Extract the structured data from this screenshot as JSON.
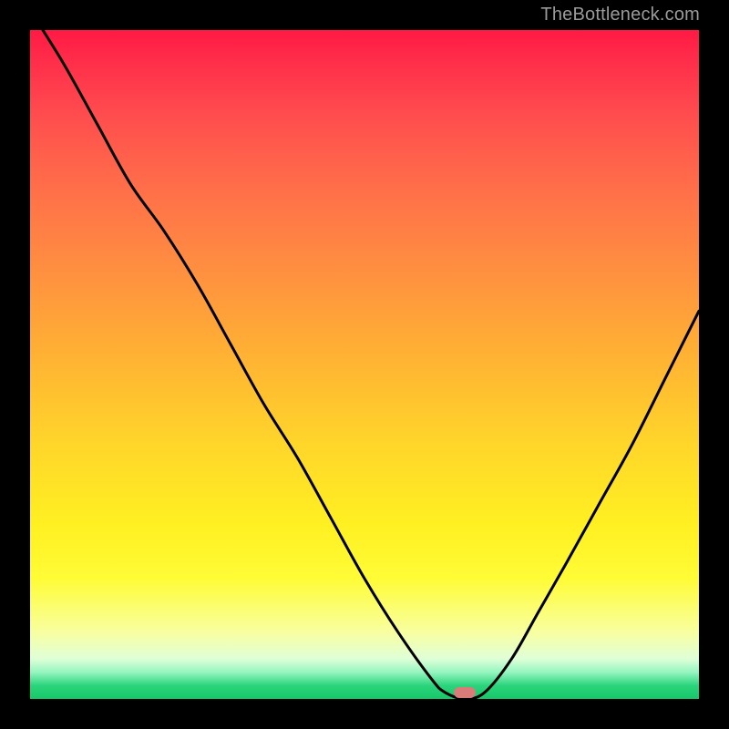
{
  "watermark": "TheBottleneck.com",
  "marker": {
    "x_pct": 65.0,
    "y_pct": 99.0
  },
  "colors": {
    "background": "#000000",
    "curve": "#000000",
    "marker": "#d87b79",
    "watermark": "#9a9a9a"
  },
  "chart_data": {
    "type": "line",
    "title": "",
    "xlabel": "",
    "ylabel": "",
    "xlim": [
      0,
      100
    ],
    "ylim": [
      0,
      100
    ],
    "grid": false,
    "series": [
      {
        "name": "bottleneck-curve",
        "x": [
          0,
          5,
          10,
          15,
          20,
          25,
          30,
          35,
          40,
          45,
          50,
          55,
          60,
          62,
          65,
          68,
          72,
          76,
          80,
          85,
          90,
          95,
          100
        ],
        "values": [
          103,
          95,
          86,
          77,
          70,
          62,
          53,
          44,
          36,
          27,
          18,
          10,
          3,
          1,
          0,
          1,
          6,
          13,
          20,
          29,
          38,
          48,
          58
        ]
      }
    ],
    "annotations": [
      {
        "type": "marker",
        "x": 65,
        "y": 0,
        "shape": "pill",
        "color": "#d87b79"
      }
    ],
    "background_gradient": {
      "direction": "vertical",
      "stops": [
        {
          "pct": 0,
          "color": "#ff1a44"
        },
        {
          "pct": 22,
          "color": "#ff6a4a"
        },
        {
          "pct": 48,
          "color": "#ffb034"
        },
        {
          "pct": 74,
          "color": "#fff022"
        },
        {
          "pct": 90,
          "color": "#f8ffa0"
        },
        {
          "pct": 100,
          "color": "#16c86a"
        }
      ]
    }
  }
}
